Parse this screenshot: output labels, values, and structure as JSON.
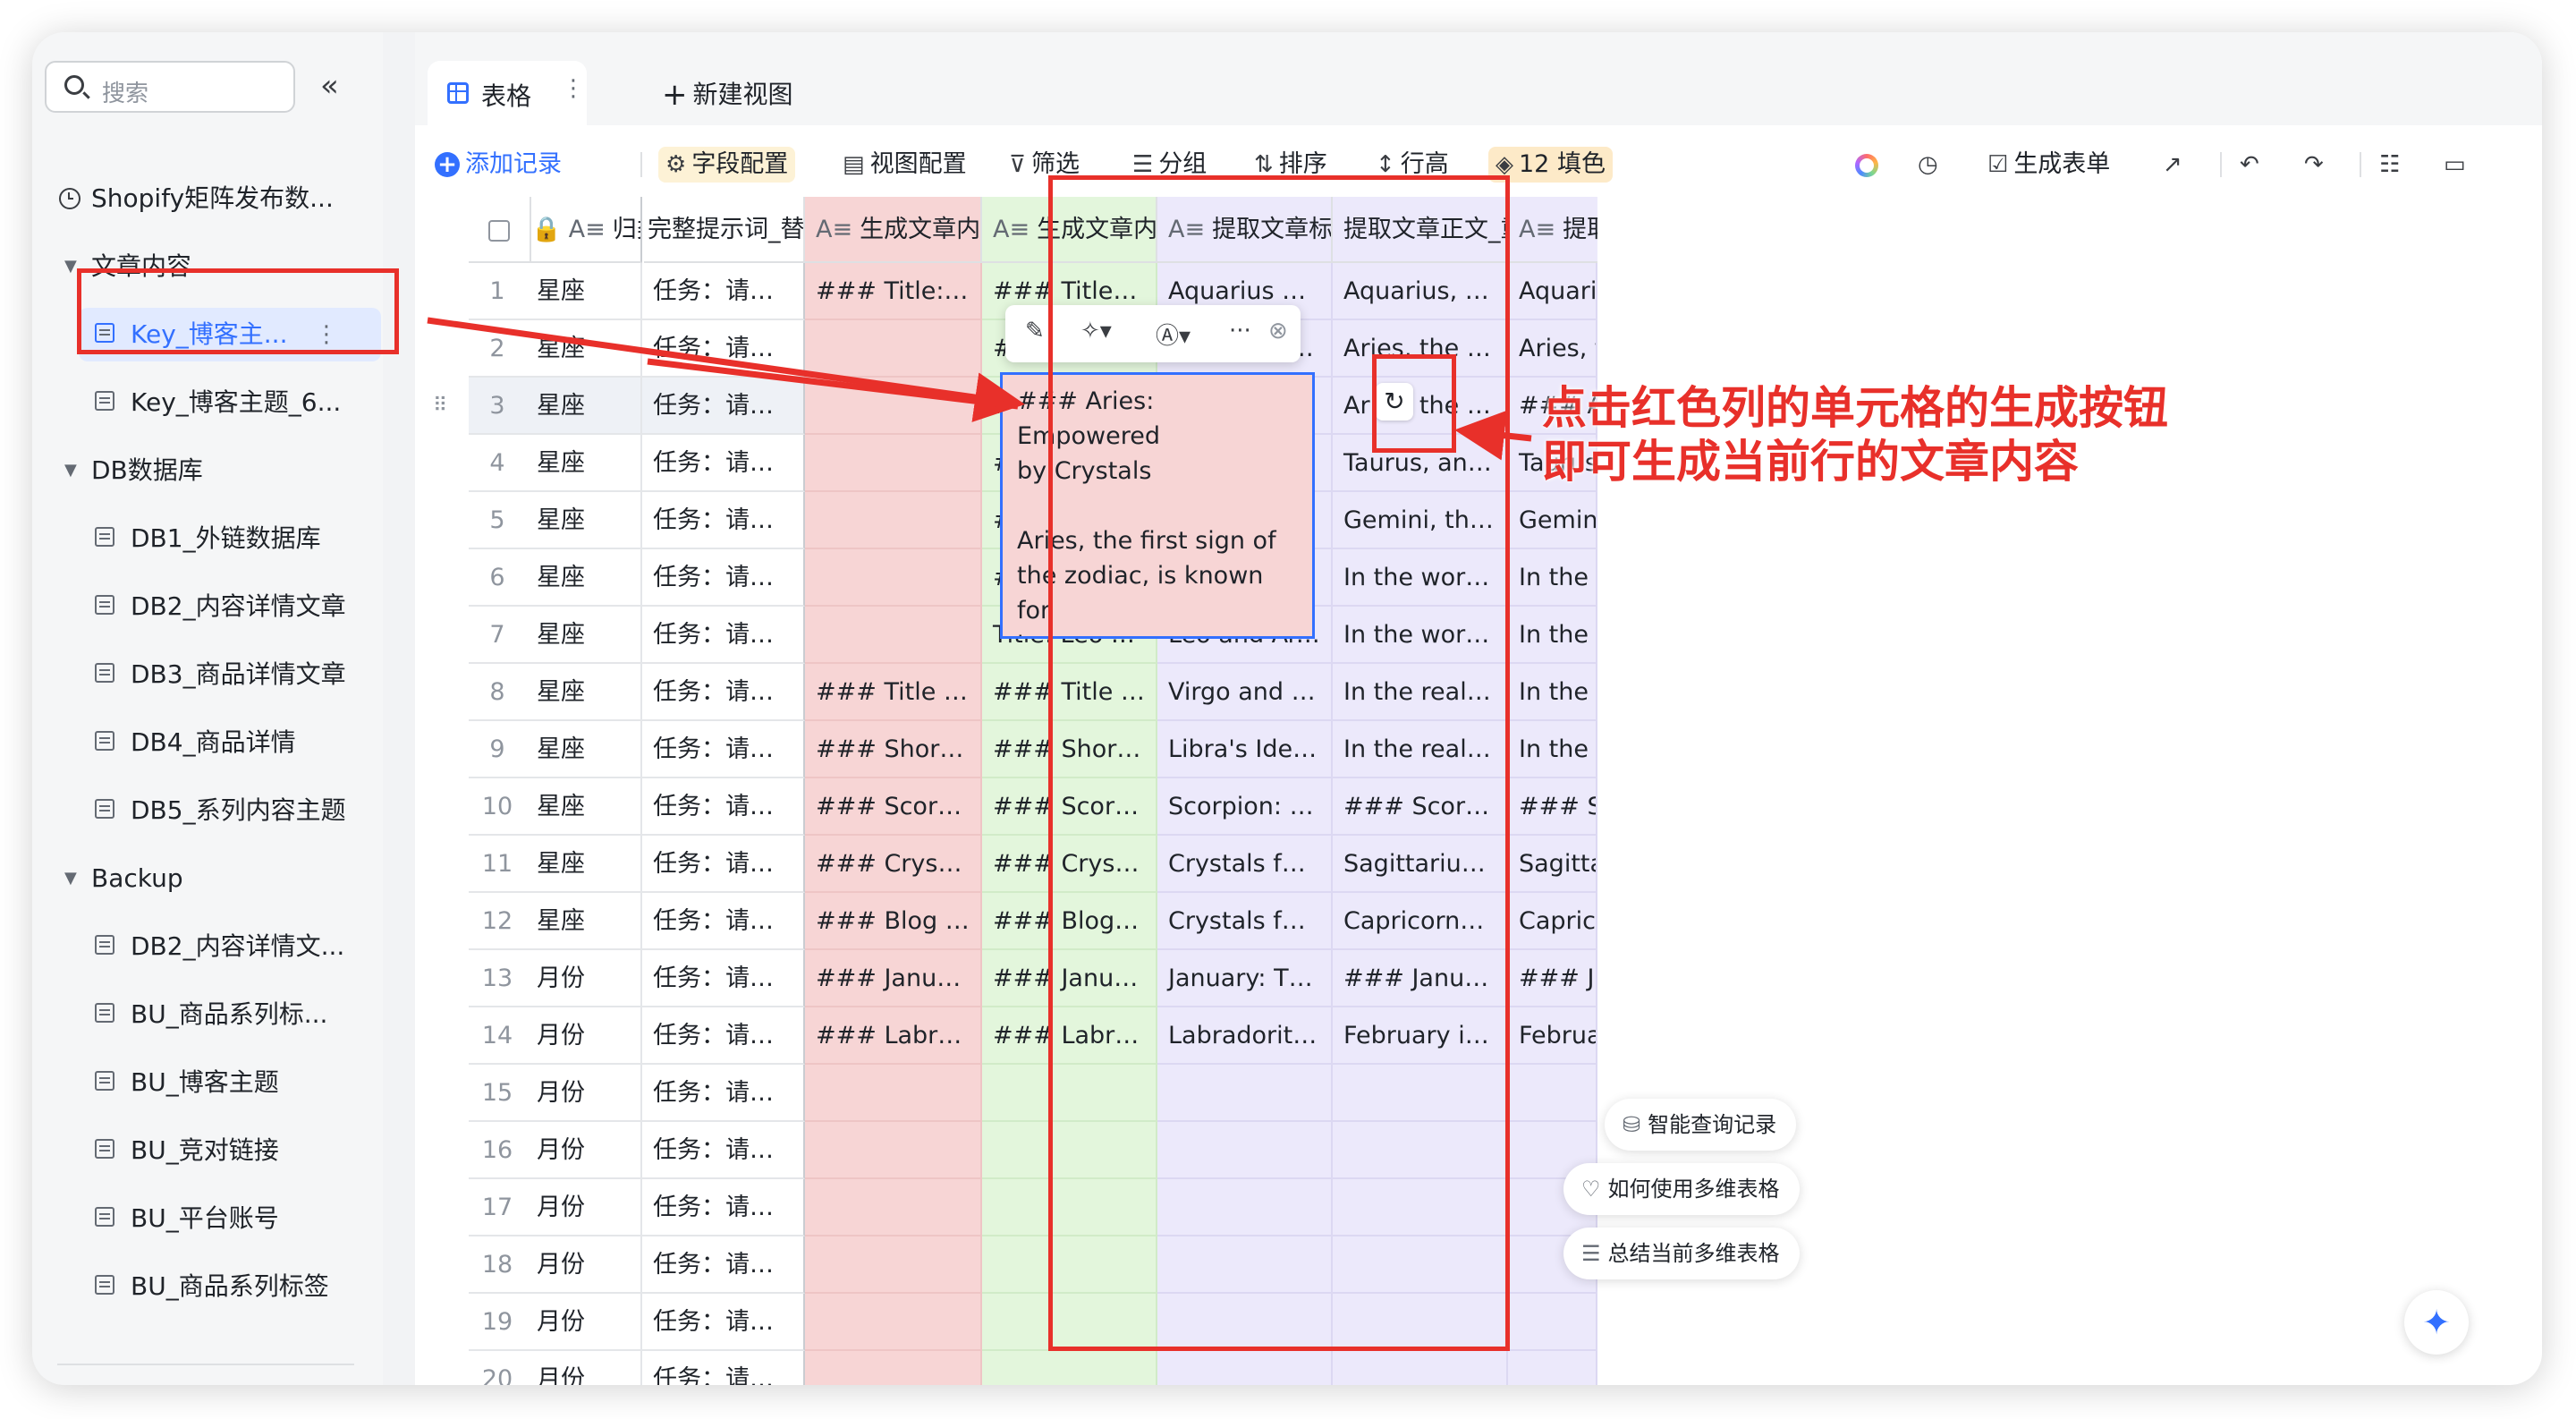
{
  "sidebar": {
    "search_placeholder": "搜索",
    "collapse_icon": "«",
    "items": [
      {
        "label": "Shopify矩阵发布数..."
      },
      {
        "label": "文章内容"
      },
      {
        "label": "Key_博客主..."
      },
      {
        "label": "Key_博客主题_6..."
      },
      {
        "label": "DB数据库"
      },
      {
        "label": "DB1_外链数据库"
      },
      {
        "label": "DB2_内容详情文章"
      },
      {
        "label": "DB3_商品详情文章"
      },
      {
        "label": "DB4_商品详情"
      },
      {
        "label": "DB5_系列内容主题"
      },
      {
        "label": "Backup"
      },
      {
        "label": "DB2_内容详情文..."
      },
      {
        "label": "BU_商品系列标..."
      },
      {
        "label": "BU_博客主题"
      },
      {
        "label": "BU_竞对链接"
      },
      {
        "label": "BU_平台账号"
      },
      {
        "label": "BU_商品系列标签"
      }
    ]
  },
  "view_tabs": {
    "active": "表格",
    "new_view": "新建视图"
  },
  "toolbar": {
    "add_record": "添加记录",
    "field_config": "字段配置",
    "view_config": "视图配置",
    "filter": "筛选",
    "group": "分组",
    "sort": "排序",
    "row_height": "行高",
    "fill": "12 填色",
    "generate_form": "生成表单"
  },
  "columns": [
    {
      "label": "归类"
    },
    {
      "label": "完整提示词_替换"
    },
    {
      "label": "生成文章内容"
    },
    {
      "label": "生成文章内容_带外链"
    },
    {
      "label": "提取文章标题",
      "ai": "AI"
    },
    {
      "label": "提取文章正文_重点",
      "ai": "AI"
    },
    {
      "label": "提取文章"
    }
  ],
  "rows": [
    {
      "n": "1",
      "cat": "星座",
      "prompt": "任务：请你按照如下要...",
      "gen": "### Title: Aquarius and...",
      "link": "### Title: Aquarius and...",
      "title": "Aquarius and the Heali...",
      "body": "Aquarius, the water - b...",
      "ext": "Aquarius, th"
    },
    {
      "n": "2",
      "cat": "星座",
      "prompt": "任务：请你按照如下要...",
      "gen": "",
      "link": "### Title Aries and Afri...",
      "title": "Aries and African Blood...",
      "body": "Aries, the first sign of t...",
      "ext": "Aries, the fir"
    },
    {
      "n": "3",
      "cat": "星座",
      "prompt": "任务：请你按照如下要...",
      "gen": "",
      "link": "### Aries: Empowered...",
      "title": "",
      "body": "Aries, the first sign of t...",
      "ext": "### Aries: E"
    },
    {
      "n": "4",
      "cat": "星座",
      "prompt": "任务：请你按照如下要...",
      "gen": "",
      "link": "### Crystals for Taurus...",
      "title": "",
      "body": "Taurus, an earth sign, i...",
      "ext": "Taurus, an e"
    },
    {
      "n": "5",
      "cat": "星座",
      "prompt": "任务：请你按照如下要...",
      "gen": "",
      "link": "# Title Gemini and Afric...",
      "title": "Gemini and African Blo...",
      "body": "Gemini, the third astrol...",
      "ext": "Gemini, the"
    },
    {
      "n": "6",
      "cat": "星座",
      "prompt": "任务：请你按照如下要...",
      "gen": "",
      "link": "### Title Cancer and A...",
      "title": "Cancer and African Blo...",
      "body": "In the world of astrolog...",
      "ext": "In the world"
    },
    {
      "n": "7",
      "cat": "星座",
      "prompt": "任务：请你按照如下要...",
      "gen": "",
      "link": "Title: Leo and African B...",
      "title": "Leo and African BloodS...",
      "body": "In the world of crystals ...",
      "ext": "In the world"
    },
    {
      "n": "8",
      "cat": "星座",
      "prompt": "任务：请你按照如下要...",
      "gen": "### Title Virgo and Afri...",
      "link": "### Title Virgo and Afri...",
      "title": "Virgo and African Bloo...",
      "body": "In the realm of astrolog...",
      "ext": "In the realm"
    },
    {
      "n": "9",
      "cat": "星座",
      "prompt": "任务：请你按照如下要...",
      "gen": "### Short Title Libra's I...",
      "link": "### Short Title Libra's I...",
      "title": "Libra's Ideal Crystals: A...",
      "body": "In the realm of astrolog...",
      "ext": "In the realm"
    },
    {
      "n": "10",
      "cat": "星座",
      "prompt": "任务：请你按照如下要...",
      "gen": "### Scorpion: The Perf...",
      "link": "### Scorpion: The Perf...",
      "title": "Scorpion: The Perfect ...",
      "body": "### Scorpion: The Perf...",
      "ext": "### Scorpic"
    },
    {
      "n": "11",
      "cat": "星座",
      "prompt": "任务：请你按照如下要...",
      "gen": "### Crystals for Sagitt...",
      "link": "### Crystals for Sagitt...",
      "title": "Crystals for Sagittarius:...",
      "body": "Sagittarius is a fire sign...",
      "ext": "Sagittarius i"
    },
    {
      "n": "12",
      "cat": "星座",
      "prompt": "任务：请你按照如下要...",
      "gen": "### Blog Title Crystals ...",
      "link": "### Blog Title Crystals ...",
      "title": "Crystals for Capricorn: ...",
      "body": "Capricorns are known f...",
      "ext": "Capricorns"
    },
    {
      "n": "13",
      "cat": "月份",
      "prompt": "任务：请你按照如下要...",
      "gen": "### January: The Mont...",
      "link": "### January: The Mont...",
      "title": "January: The Month of ...",
      "body": "### January: The Mont...",
      "ext": "### Januar"
    },
    {
      "n": "14",
      "cat": "月份",
      "prompt": "任务：请你按照如下要...",
      "gen": "### Labradorite Crysta...",
      "link": "### Labradorite Crysta...",
      "title": "Labradorite Crystals: T...",
      "body": "February is a month fill...",
      "ext": "February is"
    },
    {
      "n": "15",
      "cat": "月份",
      "prompt": "任务：请你按照如下要...",
      "gen": "",
      "link": "",
      "title": "",
      "body": "",
      "ext": ""
    },
    {
      "n": "16",
      "cat": "月份",
      "prompt": "任务：请你按照如下要...",
      "gen": "",
      "link": "",
      "title": "",
      "body": "",
      "ext": ""
    },
    {
      "n": "17",
      "cat": "月份",
      "prompt": "任务：请你按照如下要...",
      "gen": "",
      "link": "",
      "title": "",
      "body": "",
      "ext": ""
    },
    {
      "n": "18",
      "cat": "月份",
      "prompt": "任务：请你按照如下要...",
      "gen": "",
      "link": "",
      "title": "",
      "body": "",
      "ext": ""
    },
    {
      "n": "19",
      "cat": "月份",
      "prompt": "任务：请你按照如下要...",
      "gen": "",
      "link": "",
      "title": "",
      "body": "",
      "ext": ""
    },
    {
      "n": "20",
      "cat": "月份",
      "prompt": "任务：请你按照如下要...",
      "gen": "",
      "link": "",
      "title": "",
      "body": "",
      "ext": ""
    }
  ],
  "editing_cell": {
    "text": "### Aries: Empowered\nby Crystals\n\nAries, the first sign of\nthe zodiac, is known for\nits courage,\ndetermination, and\nboundless energy..."
  },
  "annotation": {
    "line1": "点击红色列的单元格的生成按钮",
    "line2": "即可生成当前行的文章内容"
  },
  "helpers": {
    "smart_query": "智能查询记录",
    "how_to_use": "如何使用多维表格",
    "summarize": "总结当前多维表格"
  },
  "colors": {
    "accent": "#3370ff",
    "annotation_red": "#e8302a",
    "gen_column_pink": "#f7d5d5",
    "link_column_green": "#e3f6dc",
    "ai_column_lavender": "#ece9fb"
  }
}
